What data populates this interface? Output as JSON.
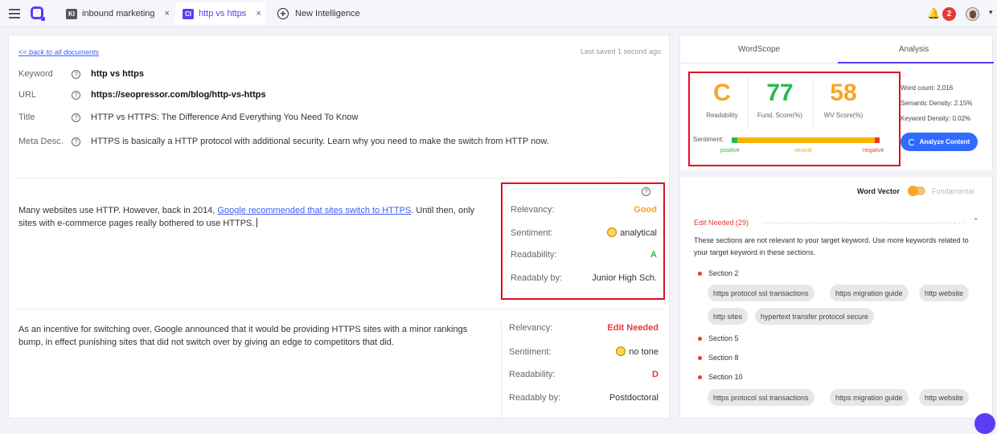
{
  "topbar": {
    "tabs": [
      {
        "icon_text": "KI",
        "icon_color": "#555555",
        "label": "inbound marketing",
        "close": "×"
      },
      {
        "icon_text": "CI",
        "icon_color": "#5b3df5",
        "label": "http vs https",
        "close": "×"
      },
      {
        "label": "New Intelligence"
      }
    ],
    "notifications_count": "2"
  },
  "document": {
    "back_link": "<< back to all documents",
    "last_saved": "Last saved 1 second ago",
    "meta": {
      "keyword_label": "Keyword",
      "keyword": "http vs https",
      "url_label": "URL",
      "url": "https://seopressor.com/blog/http-vs-https",
      "title_label": "Title",
      "title": "HTTP vs HTTPS: The Difference And Everything You Need To Know",
      "meta_label": "Meta Desc.",
      "meta_desc": "HTTPS is basically a HTTP protocol with additional security. Learn why you need to make the switch from HTTP now."
    },
    "paragraphs": [
      {
        "text_before": "Many websites use HTTP. However, back in 2014,",
        "link": "Google recommended that sites switch to HTTPS",
        "text_after": ". Until then, only sites with e-commerce pages really bothered to use HTTPS.",
        "relevancy_label": "Relevancy:",
        "relevancy": "Good",
        "sentiment_label": "Sentiment:",
        "sentiment": "analytical",
        "readability_label": "Readability:",
        "readability": "A",
        "readably_by_label": "Readably by:",
        "readably_by": "Junior High Sch."
      },
      {
        "text": "As an incentive for switching over, Google announced that it would be providing HTTPS sites with a minor rankings bump, in effect punishing sites that did not switch over by giving an edge to competitors that did.",
        "relevancy_label": "Relevancy:",
        "relevancy": "Edit Needed",
        "sentiment_label": "Sentiment:",
        "sentiment": "no tone",
        "readability_label": "Readability:",
        "readability": "D",
        "readably_by_label": "Readably by:",
        "readably_by": "Postdoctoral"
      }
    ]
  },
  "sidebar": {
    "tabs": [
      "WordScope",
      "Analysis"
    ],
    "active_tab": "Analysis",
    "scores": {
      "readability": "C",
      "readability_label": "Readability",
      "fund": "77",
      "fund_label": "Fund. Score(%)",
      "wv": "58",
      "wv_label": "WV Score(%)",
      "sentiment_label": "Sentiment:",
      "positive": "positive",
      "neutral": "neutral",
      "negative": "negative",
      "sentiment_positive_fraction": 0.04,
      "sentiment_negative_fraction": 0.03
    },
    "stats": {
      "word_count": "Word count: 2,016",
      "semantic_density": "Semantic Density: 2.15%",
      "keyword_density": "Keyword Density: 0.02%"
    },
    "analyze_button": "Analyze Content",
    "word_vector_label": "Word Vector",
    "fundamental_label": "Fundamental",
    "edit_needed": "Edit Needed (29)",
    "edit_desc": "These sections are not relevant to your target keyword. Use more keywords related to your target keyword in these sections.",
    "sections": [
      "Section 2",
      "Section 5",
      "Section 8",
      "Section 10"
    ],
    "chips_section2": [
      "https protocol ssl transactions",
      "https migration guide",
      "http website",
      "http sites",
      "hypertext transfer protocol secure"
    ],
    "chips_section10": [
      "https protocol ssl transactions",
      "https migration guide",
      "http website"
    ],
    "colors": {
      "accent": "#5b3df5",
      "good": "#f5a623",
      "bad": "#e53935",
      "green": "#2db84d",
      "highlight": "#e0101e"
    }
  }
}
